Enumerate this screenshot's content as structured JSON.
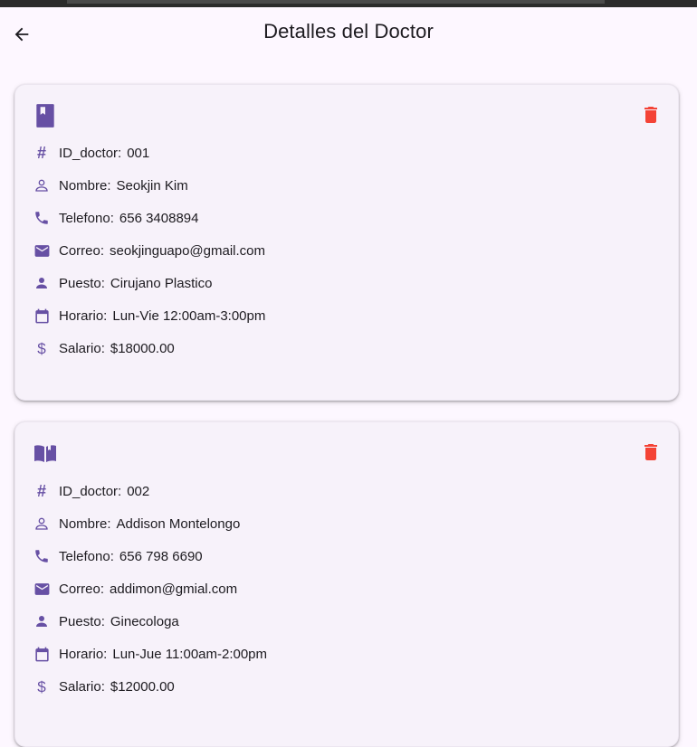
{
  "app": {
    "title": "Detalles del Doctor",
    "accent_color": "#6750a4",
    "delete_color": "#f44336"
  },
  "doctors": [
    {
      "card_icon": "book-icon",
      "id_label": "ID_doctor:",
      "id_value": "001",
      "nombre_label": "Nombre:",
      "nombre_value": "Seokjin Kim",
      "telefono_label": "Telefono:",
      "telefono_value": "656 3408894",
      "correo_label": "Correo:",
      "correo_value": "seokjinguapo@gmail.com",
      "puesto_label": "Puesto:",
      "puesto_value": "Cirujano Plastico",
      "horario_label": "Horario:",
      "horario_value": "Lun-Vie 12:00am-3:00pm",
      "salario_label": "Salario:",
      "salario_value": "$18000.00"
    },
    {
      "card_icon": "open-book-icon",
      "id_label": "ID_doctor:",
      "id_value": "002",
      "nombre_label": "Nombre:",
      "nombre_value": "Addison Montelongo",
      "telefono_label": "Telefono:",
      "telefono_value": "656 798 6690",
      "correo_label": "Correo:",
      "correo_value": "addimon@gmial.com",
      "puesto_label": "Puesto:",
      "puesto_value": "Ginecologa",
      "horario_label": "Horario:",
      "horario_value": "Lun-Jue 11:00am-2:00pm",
      "salario_label": "Salario:",
      "salario_value": "$12000.00"
    }
  ]
}
